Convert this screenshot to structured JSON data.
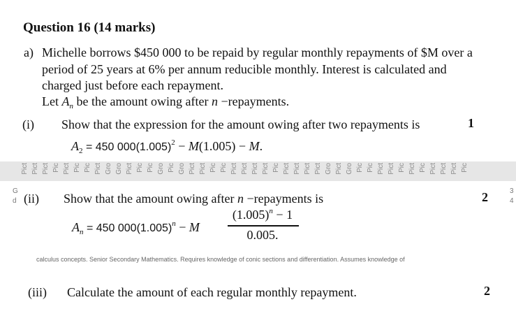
{
  "question": {
    "title": "Question 16 (14 marks)"
  },
  "part_a": {
    "label": "a)",
    "line1": "Michelle borrows $450 000 to be repaid by regular monthly repayments of $M over a",
    "line2": "period of 25 years at 6% per annum reducible monthly. Interest is calculated and",
    "line3": "charged just before each repayment.",
    "line4_pre": "Let ",
    "line4_var": "A",
    "line4_sub": "n",
    "line4_mid": " be the amount owing after ",
    "line4_n": "n",
    "line4_post": " −repayments."
  },
  "part_i": {
    "label": "(i)",
    "text": "Show that the expression for the amount owing after two repayments is",
    "marks": "1",
    "eq_lhs_var": "A",
    "eq_lhs_sub": "2",
    "eq_rhs_a": " = 450 000(1.005)",
    "eq_rhs_sup": "2",
    "eq_rhs_b": " − ",
    "eq_rhs_m": "M",
    "eq_rhs_c": "(1.005) − ",
    "eq_rhs_m2": "M",
    "eq_rhs_d": "."
  },
  "overlay_strip": {
    "labels": [
      "Pict",
      "Pict",
      "Pict",
      "Pic",
      "Pict",
      "Pic",
      "Pic",
      "Pict",
      "Gro",
      "Gro",
      "Pict",
      "Pic",
      "Pic",
      "Gro",
      "Pic",
      "Gro",
      "Pict",
      "Pict",
      "Pic",
      "Pic",
      "Pict",
      "Pict",
      "Pict",
      "Pict",
      "Pic",
      "Pict",
      "Pict",
      "Pict",
      "Pict",
      "Gro",
      "Pict",
      "Gro",
      "Pic",
      "Pic",
      "Pict",
      "Pict",
      "Pic",
      "Pict",
      "Pic",
      "Pict",
      "Pict",
      "Pict",
      "Pic"
    ]
  },
  "edge_marks": {
    "left_top": "G",
    "left_bottom": "d",
    "right_top": "3",
    "right_bottom": "4"
  },
  "part_ii": {
    "label": "(ii)",
    "text_pre": "Show that the amount owing after ",
    "text_n": "n",
    "text_post": " −repayments is",
    "marks": "2",
    "eq_lhs_var": "A",
    "eq_lhs_sub": "n",
    "eq_rhs_a": " = 450 000(1.005)",
    "eq_rhs_sup": "n",
    "eq_rhs_b": " − ",
    "eq_rhs_m": "M",
    "frac_num_a": "(1.005)",
    "frac_num_sup": "n",
    "frac_num_b": " − 1",
    "frac_den": "0.005."
  },
  "noise_line": {
    "text": "calculus concepts. Senior Secondary Mathematics. Requires knowledge of conic sections and differentiation. Assumes knowledge of"
  },
  "part_iii": {
    "label": "(iii)",
    "text": "Calculate the amount of each regular monthly repayment.",
    "marks": "2"
  }
}
